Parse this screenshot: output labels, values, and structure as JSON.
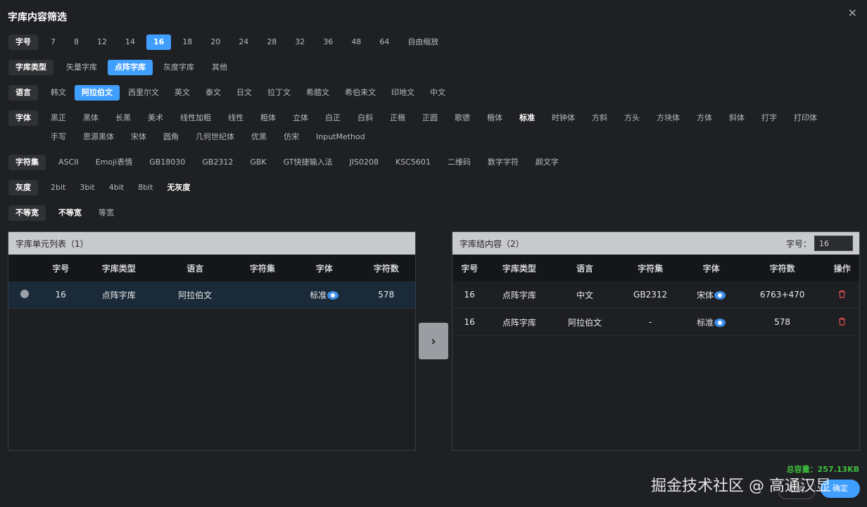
{
  "dialog": {
    "title": "字库内容筛选",
    "close": "✕"
  },
  "filters": {
    "size": {
      "label": "字号",
      "options": [
        "7",
        "8",
        "12",
        "14",
        "16",
        "18",
        "20",
        "24",
        "28",
        "32",
        "36",
        "48",
        "64",
        "自由缩放"
      ],
      "selected": "16"
    },
    "type": {
      "label": "字库类型",
      "options": [
        "矢量字库",
        "点阵字库",
        "灰度字库",
        "其他"
      ],
      "selected": "点阵字库"
    },
    "language": {
      "label": "语言",
      "options": [
        "韩文",
        "阿拉伯文",
        "西里尔文",
        "英文",
        "泰文",
        "日文",
        "拉丁文",
        "希腊文",
        "希伯来文",
        "印地文",
        "中文"
      ],
      "selected": "阿拉伯文"
    },
    "font": {
      "label": "字体",
      "options": [
        "黑正",
        "黑体",
        "长黑",
        "美术",
        "线性加粗",
        "线性",
        "粗体",
        "立体",
        "白正",
        "白斜",
        "正楷",
        "正圆",
        "歌德",
        "楷体",
        "标准",
        "时钟体",
        "方斜",
        "方头",
        "方块体",
        "方体",
        "斜体",
        "打字",
        "打印体",
        "手写",
        "思源黑体",
        "宋体",
        "圆角",
        "几何世纪体",
        "优黑",
        "仿宋",
        "InputMethod"
      ],
      "selected": "标准"
    },
    "charset": {
      "label": "字符集",
      "options": [
        "ASCII",
        "Emoji表情",
        "GB18030",
        "GB2312",
        "GBK",
        "GT快捷输入法",
        "JIS0208",
        "KSC5601",
        "二维码",
        "数字字符",
        "颜文字"
      ],
      "selected": ""
    },
    "gray": {
      "label": "灰度",
      "options": [
        "2bit",
        "3bit",
        "4bit",
        "8bit",
        "无灰度"
      ],
      "selected": "无灰度"
    },
    "width": {
      "label": "不等宽",
      "options": [
        "不等宽",
        "等宽"
      ],
      "selected": "不等宽"
    }
  },
  "left_panel": {
    "title": "字库单元列表（1）",
    "columns": [
      "",
      "字号",
      "字库类型",
      "语言",
      "字符集",
      "字体",
      "字符数"
    ],
    "rows": [
      {
        "size": "16",
        "type": "点阵字库",
        "language": "阿拉伯文",
        "charset": "",
        "font": "标准",
        "count": "578"
      }
    ]
  },
  "right_panel": {
    "title": "字库结内容（2）",
    "size_label": "字号：",
    "size_value": "16",
    "columns": [
      "字号",
      "字库类型",
      "语言",
      "字符集",
      "字体",
      "字符数",
      "操作"
    ],
    "rows": [
      {
        "size": "16",
        "type": "点阵字库",
        "language": "中文",
        "charset": "GB2312",
        "font": "宋体",
        "count": "6763+470"
      },
      {
        "size": "16",
        "type": "点阵字库",
        "language": "阿拉伯文",
        "charset": "-",
        "font": "标准",
        "count": "578"
      }
    ]
  },
  "transfer_button": "›",
  "capacity": "总容量：257.13KB",
  "buttons": {
    "cancel": "取消",
    "confirm": "确定"
  },
  "watermark": "掘金技术社区 @ 高通汉显",
  "icons": {
    "delete": "trash-icon",
    "preview": "eye-icon",
    "close": "close-icon"
  },
  "colors": {
    "accent": "#409eff",
    "capacity": "#3fbf3f",
    "delete": "#e05050"
  }
}
